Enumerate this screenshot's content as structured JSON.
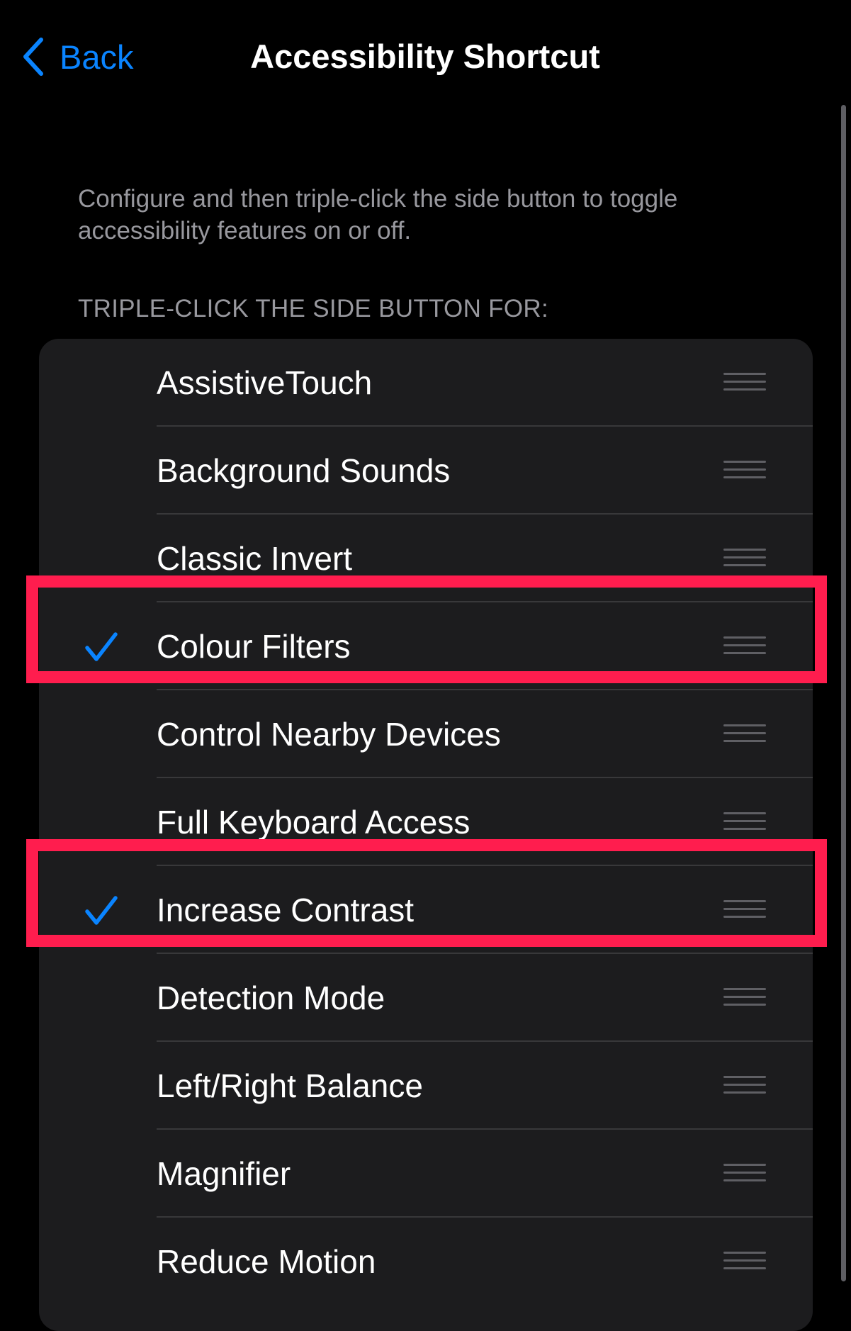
{
  "nav": {
    "back_label": "Back",
    "title": "Accessibility Shortcut"
  },
  "description": "Configure and then triple-click the side button to toggle accessibility features on or off.",
  "section_header": "TRIPLE-CLICK THE SIDE BUTTON FOR:",
  "items": [
    {
      "label": "AssistiveTouch",
      "checked": false
    },
    {
      "label": "Background Sounds",
      "checked": false
    },
    {
      "label": "Classic Invert",
      "checked": false
    },
    {
      "label": "Colour Filters",
      "checked": true,
      "highlighted": true
    },
    {
      "label": "Control Nearby Devices",
      "checked": false
    },
    {
      "label": "Full Keyboard Access",
      "checked": false
    },
    {
      "label": "Increase Contrast",
      "checked": true,
      "highlighted": true
    },
    {
      "label": "Detection Mode",
      "checked": false
    },
    {
      "label": "Left/Right Balance",
      "checked": false
    },
    {
      "label": "Magnifier",
      "checked": false
    },
    {
      "label": "Reduce Motion",
      "checked": false
    }
  ],
  "colors": {
    "accent": "#0a84ff",
    "highlight": "#ff1d4e",
    "background": "#000000",
    "list_background": "#1c1c1e",
    "secondary_text": "#98989e"
  },
  "icons": {
    "back": "chevron-left-icon",
    "check": "checkmark-icon",
    "reorder": "reorder-grip-icon"
  }
}
